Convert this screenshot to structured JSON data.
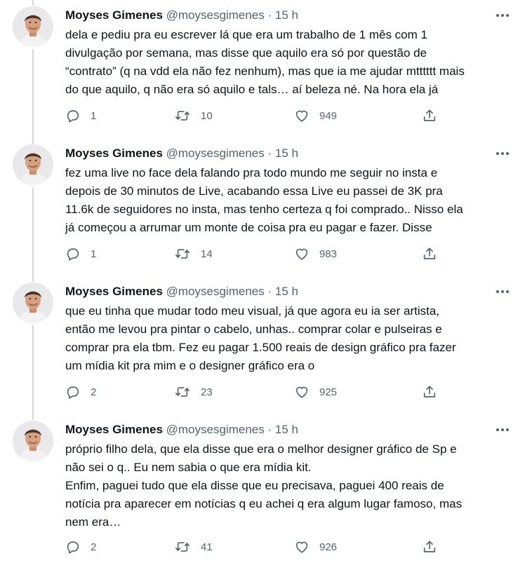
{
  "tweets": [
    {
      "author": {
        "name": "Moyses Gimenes",
        "handle": "@moysesgimenes"
      },
      "separator": "·",
      "time": "15 h",
      "lines": [
        "dela e pediu pra eu escrever lá que era um trabalho de 1 mês com 1",
        "divulgação por semana, mas disse que aquilo era só por questão de",
        "“contrato” (q na vdd ela não fez nenhum), mas que ia me ajudar mtttttt mais",
        "do que aquilo, q não era só aquilo e tals… aí beleza né. Na hora ela já"
      ],
      "replies": "1",
      "retweets": "10",
      "likes": "949"
    },
    {
      "author": {
        "name": "Moyses Gimenes",
        "handle": "@moysesgimenes"
      },
      "separator": "·",
      "time": "15 h",
      "lines": [
        "fez uma live no face dela falando pra todo mundo me seguir no insta e",
        "depois de 30 minutos de Live, acabando essa Live eu passei de 3K pra",
        "11.6k de seguidores no insta, mas tenho certeza q foi comprado.. Nisso ela",
        "já começou a arrumar um monte de coisa pra eu pagar e fazer. Disse"
      ],
      "replies": "1",
      "retweets": "14",
      "likes": "983"
    },
    {
      "author": {
        "name": "Moyses Gimenes",
        "handle": "@moysesgimenes"
      },
      "separator": "·",
      "time": "15 h",
      "lines": [
        "que eu tinha que mudar todo meu visual, já que agora eu ia ser artista,",
        "então me levou pra pintar o cabelo, unhas.. comprar colar e pulseiras e",
        "comprar pra ela tbm. Fez eu pagar 1.500 reais de design gráfico pra fazer",
        "um mídia kit pra mim e o designer gráfico era o"
      ],
      "replies": "2",
      "retweets": "23",
      "likes": "925"
    },
    {
      "author": {
        "name": "Moyses Gimenes",
        "handle": "@moysesgimenes"
      },
      "separator": "·",
      "time": "15 h",
      "lines": [
        "próprio filho dela, que ela disse que era o melhor designer gráfico de Sp e",
        "não sei o q.. Eu nem sabia o que era mídia kit.",
        "Enfim, paguei tudo que ela disse que eu precisava, paguei 400 reais de",
        "notícia pra aparecer em notícias q eu achei q era algum lugar famoso, mas",
        "nem era…"
      ],
      "replies": "2",
      "retweets": "41",
      "likes": "926"
    }
  ],
  "icons": {
    "reply": "reply-icon",
    "retweet": "retweet-icon",
    "like": "heart-icon",
    "share": "share-icon",
    "more": "more-icon"
  },
  "colors": {
    "text": "#0f1419",
    "secondary": "#536471",
    "thread_line": "#cfd9de"
  }
}
